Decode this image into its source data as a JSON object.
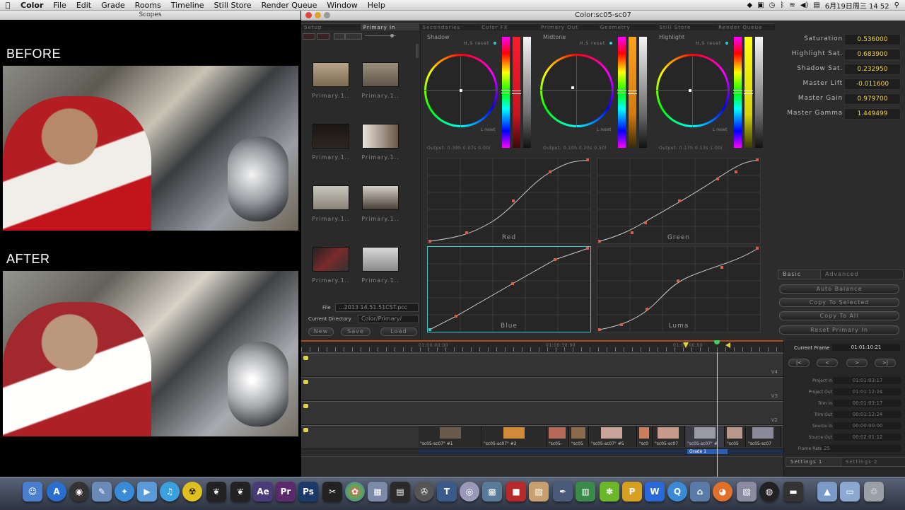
{
  "menubar": {
    "app_name": "Color",
    "items": [
      "File",
      "Edit",
      "Grade",
      "Rooms",
      "Timeline",
      "Still Store",
      "Render Queue",
      "Window",
      "Help"
    ],
    "clock": "6月19日周三  14 52"
  },
  "scopes": {
    "window_title": "Scopes",
    "before_label": "BEFORE",
    "after_label": "AFTER"
  },
  "color_window": {
    "title": "Color:sc05-sc07",
    "tabs": [
      "Setup",
      "Primary In",
      "Secondaries",
      "Color FX",
      "Primary Out",
      "Geometry",
      "Still Store",
      "Render Queue"
    ],
    "active_tab": "Primary In"
  },
  "browser": {
    "thumbnails": [
      {
        "label": "Primary.1.."
      },
      {
        "label": "Primary.1.."
      },
      {
        "label": "Primary.1.."
      },
      {
        "label": "Primary.1.."
      },
      {
        "label": "Primary.1.."
      },
      {
        "label": "Primary.1.."
      },
      {
        "label": "Primary.1.."
      },
      {
        "label": "Primary.1.."
      }
    ],
    "file_label": "File",
    "file_value": "...2013 14.51.51CST.pcc",
    "dir_label": "Current Directory",
    "dir_value": "Color/Primary/",
    "new_label": "New",
    "save_label": "Save",
    "load_label": "Load"
  },
  "wheels": {
    "shadow": {
      "label": "Shadow",
      "reset": "H,S reset",
      "lreset": "L reset",
      "output": "Output:  0.39h 0.07s 0.00l"
    },
    "midtone": {
      "label": "Midtone",
      "reset": "H,S reset",
      "lreset": "L reset",
      "output": "Output:  0.10h 0.20s 0.50l"
    },
    "highlight": {
      "label": "Highlight",
      "reset": "H,S reset",
      "lreset": "L reset",
      "output": "Output:  0.17h 0.13s 1.00l"
    }
  },
  "curves": {
    "red": "Red",
    "green": "Green",
    "blue": "Blue",
    "luma": "Luma"
  },
  "params": [
    {
      "label": "Saturation",
      "value": "0.536000"
    },
    {
      "label": "Highlight Sat.",
      "value": "0.683900"
    },
    {
      "label": "Shadow Sat.",
      "value": "0.232950"
    },
    {
      "label": "Master Lift",
      "value": "-0.011600"
    },
    {
      "label": "Master Gain",
      "value": "0.979700"
    },
    {
      "label": "Master Gamma",
      "value": "1.449499"
    }
  ],
  "subtabs": {
    "basic": "Basic",
    "advanced": "Advanced"
  },
  "buttons": {
    "auto_balance": "Auto Balance",
    "copy_selected": "Copy To Selected",
    "copy_all": "Copy To All",
    "reset_primary": "Reset Primary In"
  },
  "timeline": {
    "ruler_labels": [
      "01:00:00:00",
      "01:00:30:00",
      "01:01:00:00"
    ],
    "tracks": [
      "V4",
      "V3",
      "V2",
      ""
    ],
    "clips": [
      {
        "name": "\"sc05-sc07\" #1"
      },
      {
        "name": "\"sc05-sc07\" #2"
      },
      {
        "name": "\"sc05-"
      },
      {
        "name": "\"sc05"
      },
      {
        "name": "\"sc05-sc07\" #5"
      },
      {
        "name": "\"sc0"
      },
      {
        "name": "\"sc05-sc07"
      },
      {
        "name": "\"sc05-sc07\" #"
      },
      {
        "name": "\"sc05"
      },
      {
        "name": "\"sc05-sc07"
      }
    ],
    "grade_label": "Grade 1"
  },
  "timing": {
    "current_frame_label": "Current Frame",
    "current_frame_value": "01:01:10:21",
    "nav": [
      "|<",
      "<",
      ">",
      ">|"
    ],
    "rows": [
      {
        "label": "Project In",
        "value": "01:01:03:17"
      },
      {
        "label": "Project Out",
        "value": "01:01:12:24"
      },
      {
        "label": "Trim In",
        "value": "00:01:03:17"
      },
      {
        "label": "Trim Out",
        "value": "00:01:12:24"
      },
      {
        "label": "Source In",
        "value": "00:00:00:00"
      },
      {
        "label": "Source Out",
        "value": "00:02:01:12"
      },
      {
        "label": "Frame Rate",
        "value": "25"
      }
    ],
    "settings1": "Settings 1",
    "settings2": "Settings 2"
  },
  "dock": {
    "ae_label": "Ae",
    "pr_label": "Pr",
    "ps_label": "Ps"
  }
}
